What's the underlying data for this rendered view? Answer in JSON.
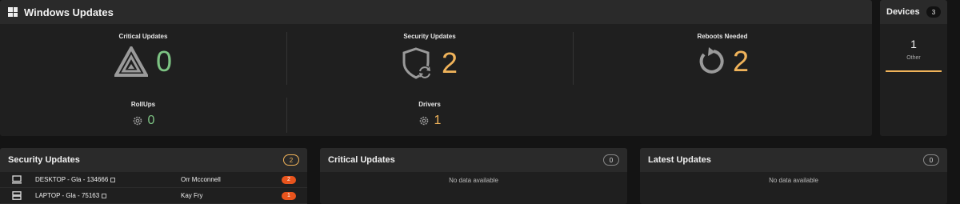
{
  "windows_updates": {
    "title": "Windows Updates",
    "critical": {
      "label": "Critical Updates",
      "value": "0",
      "icon": "warning-triangle-icon"
    },
    "security": {
      "label": "Security Updates",
      "value": "2",
      "icon": "shield-sync-icon"
    },
    "reboots": {
      "label": "Reboots Needed",
      "value": "2",
      "icon": "restart-icon"
    },
    "rollups": {
      "label": "RollUps",
      "value": "0",
      "icon": "gear-icon"
    },
    "drivers": {
      "label": "Drivers",
      "value": "1",
      "icon": "gear-icon"
    }
  },
  "devices": {
    "title": "Devices",
    "count": "3",
    "value": "1",
    "label": "Other"
  },
  "security_updates": {
    "title": "Security Updates",
    "count": "2",
    "rows": [
      {
        "device": "DESKTOP - Gla - 134666",
        "user": "Orr Mcconnell",
        "count": "2",
        "icon": "desktop-icon"
      },
      {
        "device": "LAPTOP - Gla - 75163",
        "user": "Kay Fry",
        "count": "1",
        "icon": "server-icon"
      }
    ]
  },
  "critical_updates": {
    "title": "Critical Updates",
    "count": "0",
    "empty": "No data available"
  },
  "latest_updates": {
    "title": "Latest Updates",
    "count": "0",
    "empty": "No data available"
  },
  "colors": {
    "green": "#7dc383",
    "orange": "#f0b35a",
    "pill": "#e8541d"
  }
}
